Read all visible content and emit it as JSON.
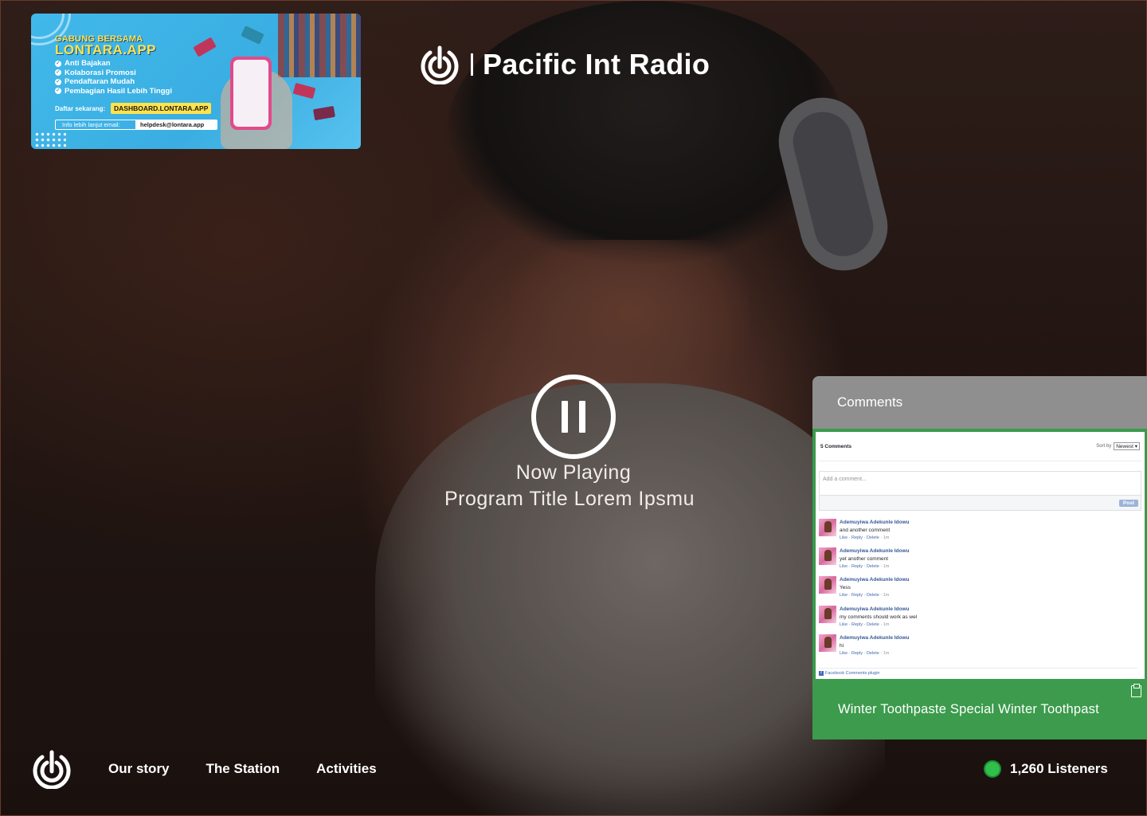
{
  "brand": {
    "title": "Pacific Int Radio"
  },
  "ad": {
    "head_line1": "GABUNG BERSAMA",
    "head_line2": "LONTARA.APP",
    "benefits": [
      "Anti Bajakan",
      "Kolaborasi Promosi",
      "Pendaftaran Mudah",
      "Pembagian Hasil Lebih Tinggi"
    ],
    "register_label": "Daftar sekarang:",
    "register_url": "DASHBOARD.LONTARA.APP",
    "info_label": "Info lebih lanjut email:",
    "info_email": "helpdesk@lontara.app"
  },
  "player": {
    "now_playing_label": "Now Playing",
    "program_title": "Program Title Lorem Ipsmu"
  },
  "comments": {
    "header": "Comments",
    "count_label": "5 Comments",
    "sort_label": "Sort by",
    "sort_value": "Newest",
    "input_placeholder": "Add a comment...",
    "post_label": "Post",
    "items": [
      {
        "author": "Ademuyiwa Adekunle Idowu",
        "text": "and another comment",
        "like": "Like",
        "reply": "Reply",
        "delete": "Delete",
        "time": "1m"
      },
      {
        "author": "Ademuyiwa Adekunle Idowu",
        "text": "yet another comment",
        "like": "Like",
        "reply": "Reply",
        "delete": "Delete",
        "time": "1m"
      },
      {
        "author": "Ademuyiwa Adekunle Idowu",
        "text": "Yess",
        "like": "Like",
        "reply": "Reply",
        "delete": "Delete",
        "time": "1m"
      },
      {
        "author": "Ademuyiwa Adekunle Idowu",
        "text": "my comments should work as wel",
        "like": "Like",
        "reply": "Reply",
        "delete": "Delete",
        "time": "1m"
      },
      {
        "author": "Ademuyiwa Adekunle Idowu",
        "text": "hi",
        "like": "Like",
        "reply": "Reply",
        "delete": "Delete",
        "time": "1m"
      }
    ],
    "plugin_label": "Facebook Comments plugin",
    "footer_text": "Winter Toothpaste Special Winter Toothpast"
  },
  "nav": {
    "items": [
      "Our story",
      "The Station",
      "Activities"
    ]
  },
  "listeners": {
    "label": "1,260 Listeners"
  },
  "colors": {
    "accent_green": "#3c9b4c",
    "live_green": "#2fbf4a",
    "header_gray": "#8f8f8f"
  },
  "icons": {
    "logo": "radio-power-logo-icon",
    "pause": "pause-icon",
    "clipboard": "clipboard-icon",
    "live": "live-dot-icon"
  }
}
